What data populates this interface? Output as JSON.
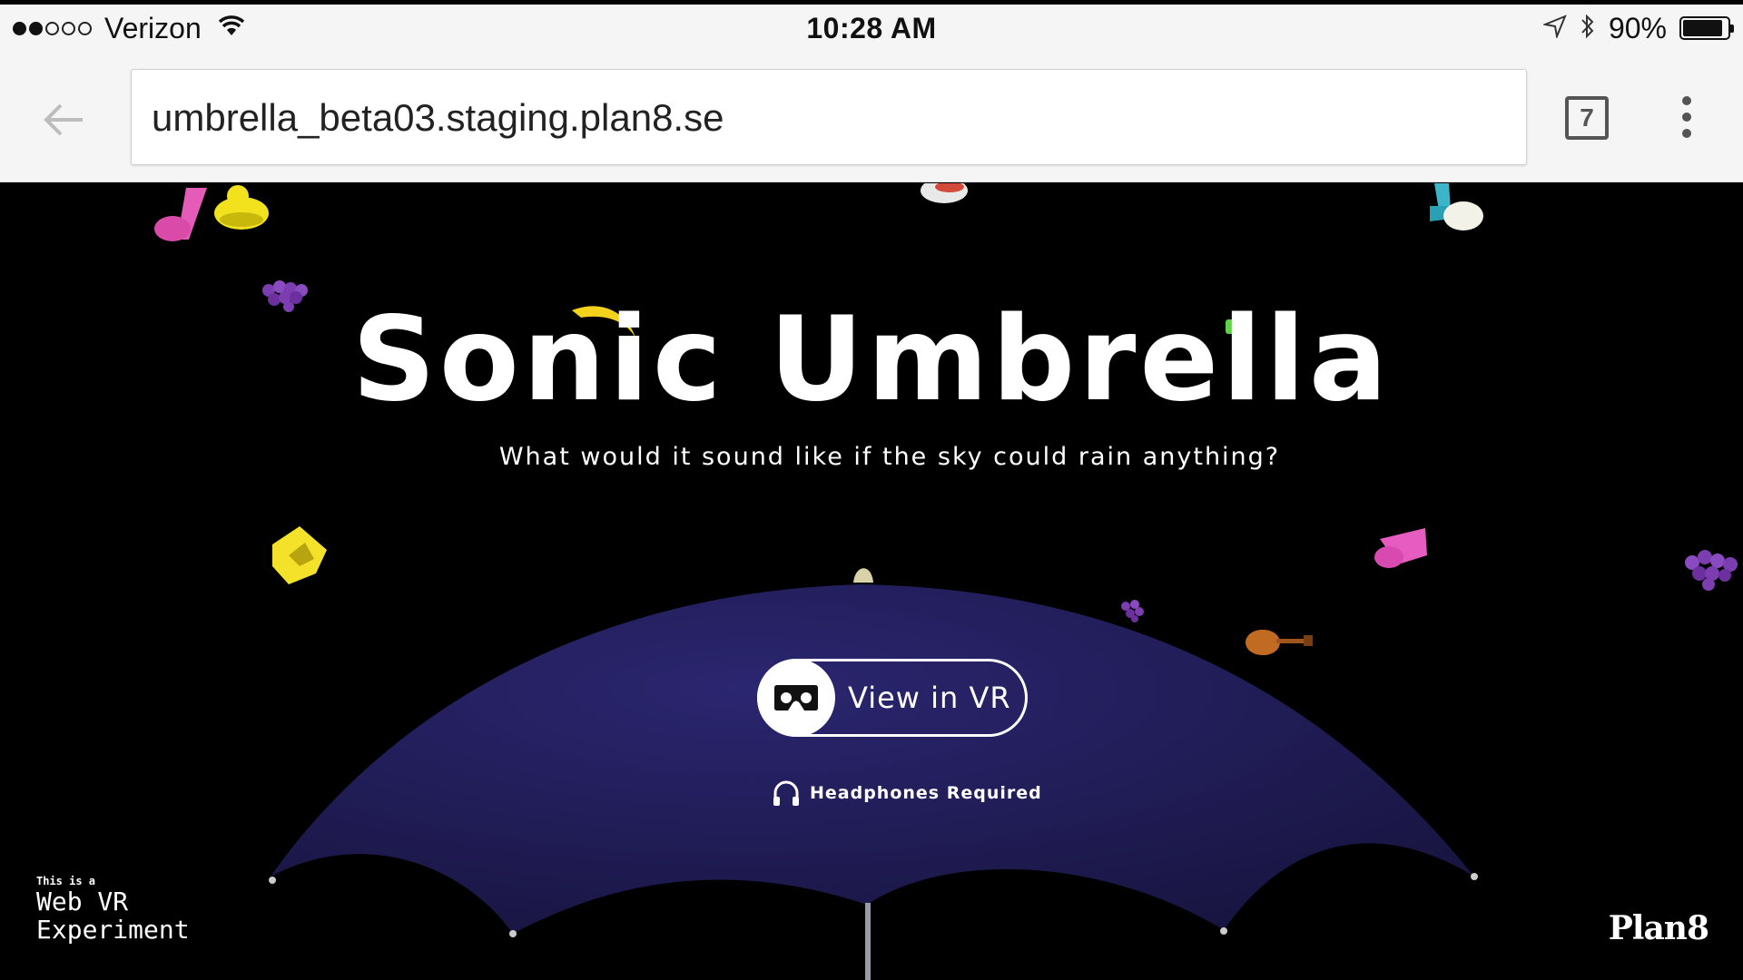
{
  "status_bar": {
    "signal_strength": 2,
    "signal_total": 5,
    "carrier": "Verizon",
    "time": "10:28 AM",
    "battery_percent": "90%",
    "battery_level": 0.9,
    "icons": [
      "wifi-icon",
      "location-arrow-icon",
      "bluetooth-icon",
      "battery-icon"
    ]
  },
  "browser": {
    "url": "umbrella_beta03.staging.plan8.se",
    "tab_count": "7",
    "icons": [
      "back-arrow-icon",
      "tabs-icon",
      "overflow-menu-icon"
    ]
  },
  "page": {
    "title": "Sonic Umbrella",
    "subtitle": "What would it sound like if the sky could rain anything?",
    "vr_button_label": "View in VR",
    "headphones_note": "Headphones Required",
    "badge_small": "This is a",
    "badge_line1": "Web VR",
    "badge_line2": "Experiment",
    "brand": "Plan8"
  },
  "colors": {
    "background": "#000000",
    "umbrella": "#1e1a52",
    "text": "#ffffff",
    "chrome_bg": "#f5f5f5"
  }
}
